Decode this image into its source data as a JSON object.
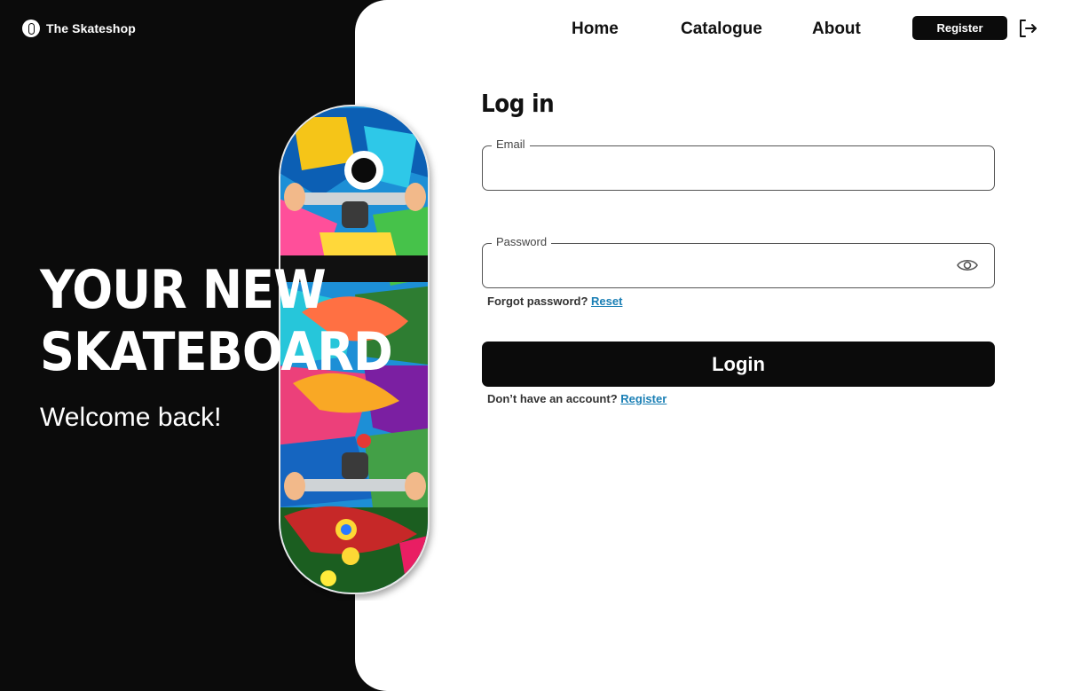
{
  "brand": {
    "name": "The Skateshop",
    "logo_icon": "skateboard-icon"
  },
  "nav": {
    "items": [
      {
        "label": "Home"
      },
      {
        "label": "Catalogue"
      },
      {
        "label": "About"
      }
    ],
    "register_label": "Register",
    "logout_icon": "logout-icon"
  },
  "hero": {
    "headline_line1": "YOUR NEW",
    "headline_line2": "SKATEBOARD",
    "subtitle": "Welcome back!",
    "image": "colorful-skateboard"
  },
  "form": {
    "title": "Log in",
    "email": {
      "label": "Email",
      "value": "",
      "placeholder": ""
    },
    "password": {
      "label": "Password",
      "value": "",
      "placeholder": "",
      "toggle_icon": "eye-icon"
    },
    "forgot_text": "Forgot password?",
    "forgot_link": "Reset",
    "submit_label": "Login",
    "signup_text": "Don’t have an account?",
    "signup_link": "Register"
  },
  "colors": {
    "dark": "#0b0b0b",
    "panel": "#ffffff",
    "link": "#1a7fb5"
  }
}
